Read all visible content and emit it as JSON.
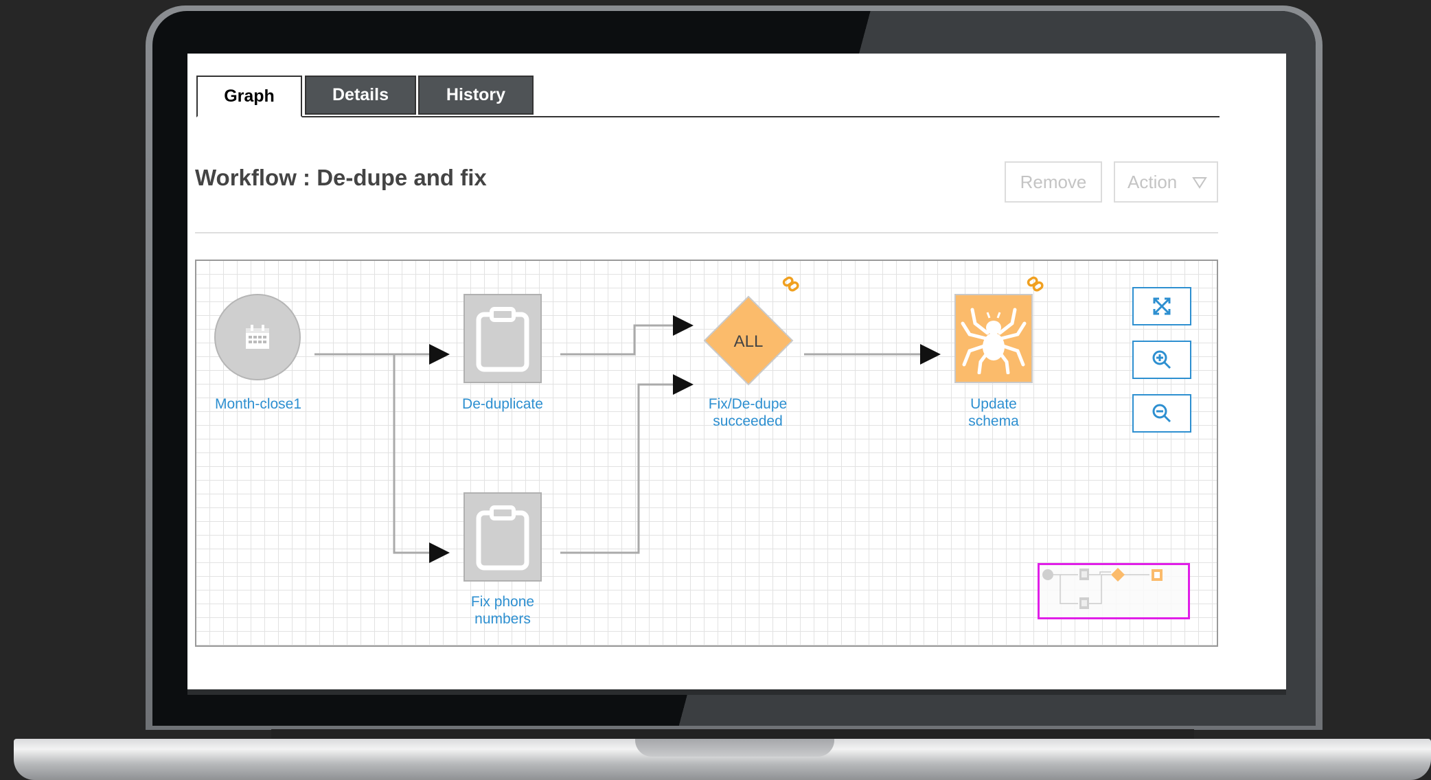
{
  "tabs": [
    {
      "label": "Graph",
      "active": true
    },
    {
      "label": "Details",
      "active": false
    },
    {
      "label": "History",
      "active": false
    }
  ],
  "workflow": {
    "title": "Workflow : De-dupe and fix"
  },
  "toolbar": {
    "remove_label": "Remove",
    "action_label": "Action"
  },
  "nodes": [
    {
      "id": "month-close1",
      "label": "Month-close1",
      "kind": "schedule-start",
      "icon": "calendar-icon"
    },
    {
      "id": "de-duplicate",
      "label": "De-duplicate",
      "kind": "task",
      "icon": "clipboard-icon"
    },
    {
      "id": "fix-phone",
      "label": "Fix phone numbers",
      "kind": "task",
      "icon": "clipboard-icon"
    },
    {
      "id": "gateway",
      "label": "Fix/De-dupe succeeded",
      "kind": "gateway",
      "gateway_text": "ALL",
      "icon": "link-icon"
    },
    {
      "id": "update-schema",
      "label": "Update schema",
      "kind": "spider-task",
      "icon": "spider-icon"
    }
  ],
  "edges": [
    [
      "month-close1",
      "de-duplicate"
    ],
    [
      "month-close1",
      "fix-phone"
    ],
    [
      "de-duplicate",
      "gateway"
    ],
    [
      "fix-phone",
      "gateway"
    ],
    [
      "gateway",
      "update-schema"
    ]
  ],
  "zoom_controls": [
    "fit-to-screen-icon",
    "zoom-in-icon",
    "zoom-out-icon"
  ],
  "colors": {
    "link": "#2d8fd0",
    "node_orange": "#fbbb6b",
    "node_gray": "#cfcfcf",
    "minimap_frame": "#e01ee8"
  }
}
